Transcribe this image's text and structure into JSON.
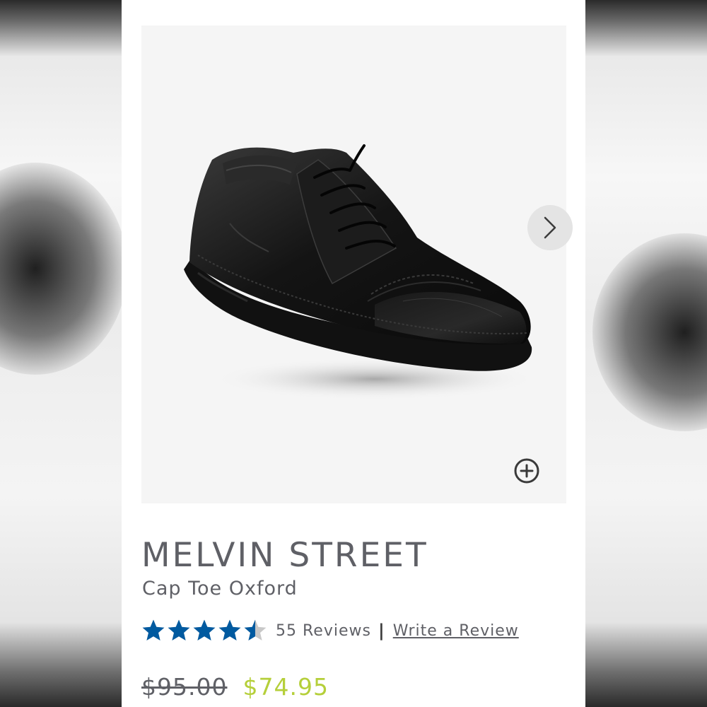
{
  "product": {
    "name": "MELVIN STREET",
    "style": "Cap Toe Oxford",
    "rating": 4.5,
    "rating_max": 5,
    "reviews_label": "55 Reviews",
    "separator": "|",
    "write_review_label": "Write a Review",
    "original_price": "$95.00",
    "sale_price": "$74.95"
  },
  "icons": {
    "next": "chevron-right-icon",
    "zoom": "zoom-plus-icon"
  },
  "colors": {
    "star": "#005aa0",
    "star_empty": "#c8c8c8",
    "sale_price": "#b5cf3a",
    "text": "#5f6066"
  }
}
